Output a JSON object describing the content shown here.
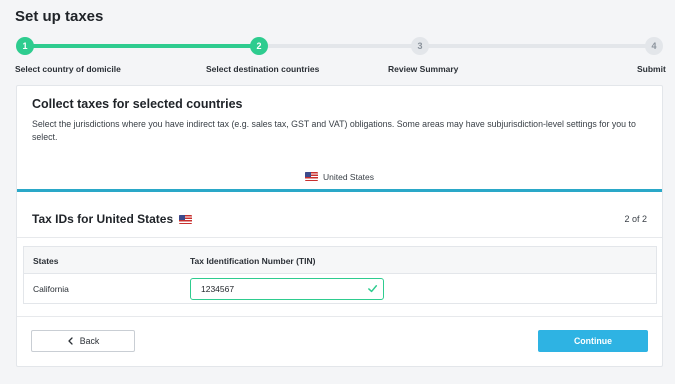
{
  "page": {
    "title": "Set up taxes"
  },
  "stepper": {
    "steps": [
      {
        "number": "1",
        "label": "Select country of domicile",
        "status": "done"
      },
      {
        "number": "2",
        "label": "Select destination countries",
        "status": "current"
      },
      {
        "number": "3",
        "label": "Review Summary",
        "status": "todo"
      },
      {
        "number": "4",
        "label": "Submit",
        "status": "todo"
      }
    ],
    "progress_fraction": 0.36
  },
  "collect": {
    "title": "Collect taxes for selected countries",
    "description": "Select the jurisdictions where you have indirect tax (e.g. sales tax, GST and VAT) obligations. Some areas may have subjurisdiction-level settings for you to select.",
    "country_tab": {
      "label": "United States",
      "flag": "us-flag-icon"
    }
  },
  "tax_ids": {
    "title": "Tax IDs for United States",
    "flag": "us-flag-icon",
    "page_count": "2 of 2",
    "table": {
      "headers": [
        "States",
        "Tax Identification Number (TIN)"
      ],
      "rows": [
        {
          "state": "California",
          "tin": "1234567",
          "valid": true
        }
      ]
    }
  },
  "footer": {
    "back_label": "Back",
    "continue_label": "Continue"
  },
  "colors": {
    "accent_green": "#2ecc8f",
    "accent_blue": "#2eb3e3",
    "tab_underline": "#2aa8c8"
  }
}
